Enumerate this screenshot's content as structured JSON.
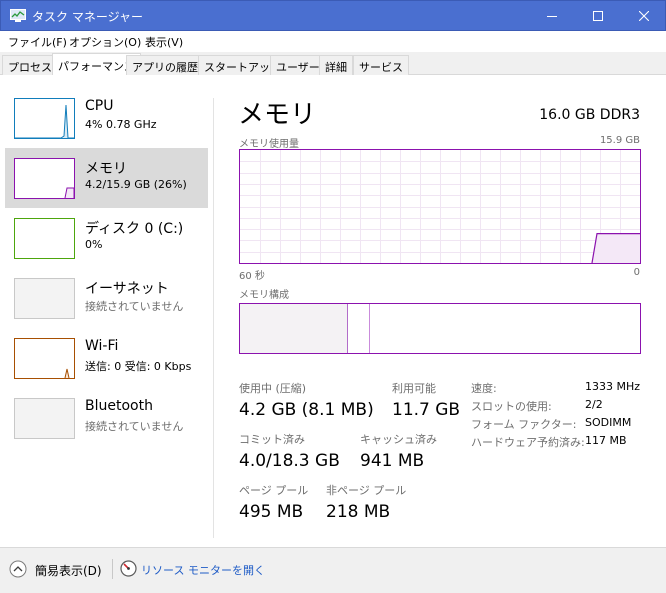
{
  "window": {
    "title": "タスク マネージャー"
  },
  "menu": {
    "file": "ファイル(F)",
    "options": "オプション(O)",
    "view": "表示(V)"
  },
  "tabs": [
    {
      "label": "プロセス"
    },
    {
      "label": "パフォーマンス",
      "active": true
    },
    {
      "label": "アプリの履歴"
    },
    {
      "label": "スタートアップ"
    },
    {
      "label": "ユーザー"
    },
    {
      "label": "詳細"
    },
    {
      "label": "サービス"
    }
  ],
  "sidebar": {
    "items": [
      {
        "name": "CPU",
        "sub": "4%  0.78 GHz",
        "color": "#117dbb"
      },
      {
        "name": "メモリ",
        "sub": "4.2/15.9 GB (26%)",
        "color": "#8b12ae",
        "selected": true
      },
      {
        "name": "ディスク 0 (C:)",
        "sub": "0%",
        "color": "#4da60c"
      },
      {
        "name": "イーサネット",
        "sub": "接続されていません",
        "color": "#a7a7a7"
      },
      {
        "name": "Wi-Fi",
        "sub": "送信: 0  受信: 0 Kbps",
        "color": "#a74f01"
      },
      {
        "name": "Bluetooth",
        "sub": "接続されていません",
        "color": "#a7a7a7"
      }
    ]
  },
  "main": {
    "title": "メモリ",
    "spec": "16.0 GB DDR3",
    "usage_graph": {
      "label": "メモリ使用量",
      "max_label": "15.9 GB",
      "time_left": "60 秒",
      "time_right": "0",
      "usage_fraction": 0.26
    },
    "composition_label": "メモリ構成",
    "stats": {
      "in_use_label": "使用中 (圧縮)",
      "in_use_value": "4.2 GB (8.1 MB)",
      "available_label": "利用可能",
      "available_value": "11.7 GB",
      "committed_label": "コミット済み",
      "committed_value": "4.0/18.3 GB",
      "cached_label": "キャッシュ済み",
      "cached_value": "941 MB",
      "paged_label": "ページ プール",
      "paged_value": "495 MB",
      "nonpaged_label": "非ページ プール",
      "nonpaged_value": "218 MB"
    },
    "info": [
      {
        "label": "速度:",
        "value": "1333 MHz"
      },
      {
        "label": "スロットの使用:",
        "value": "2/2"
      },
      {
        "label": "フォーム ファクター:",
        "value": "SODIMM"
      },
      {
        "label": "ハードウェア予約済み:",
        "value": "117 MB"
      }
    ]
  },
  "footer": {
    "fewer_details": "簡易表示(D)",
    "open_resmon": "リソース モニターを開く"
  },
  "colors": {
    "titlebar": "#4a6fd0",
    "memory": "#8b12ae",
    "link": "#1e5bc6"
  }
}
